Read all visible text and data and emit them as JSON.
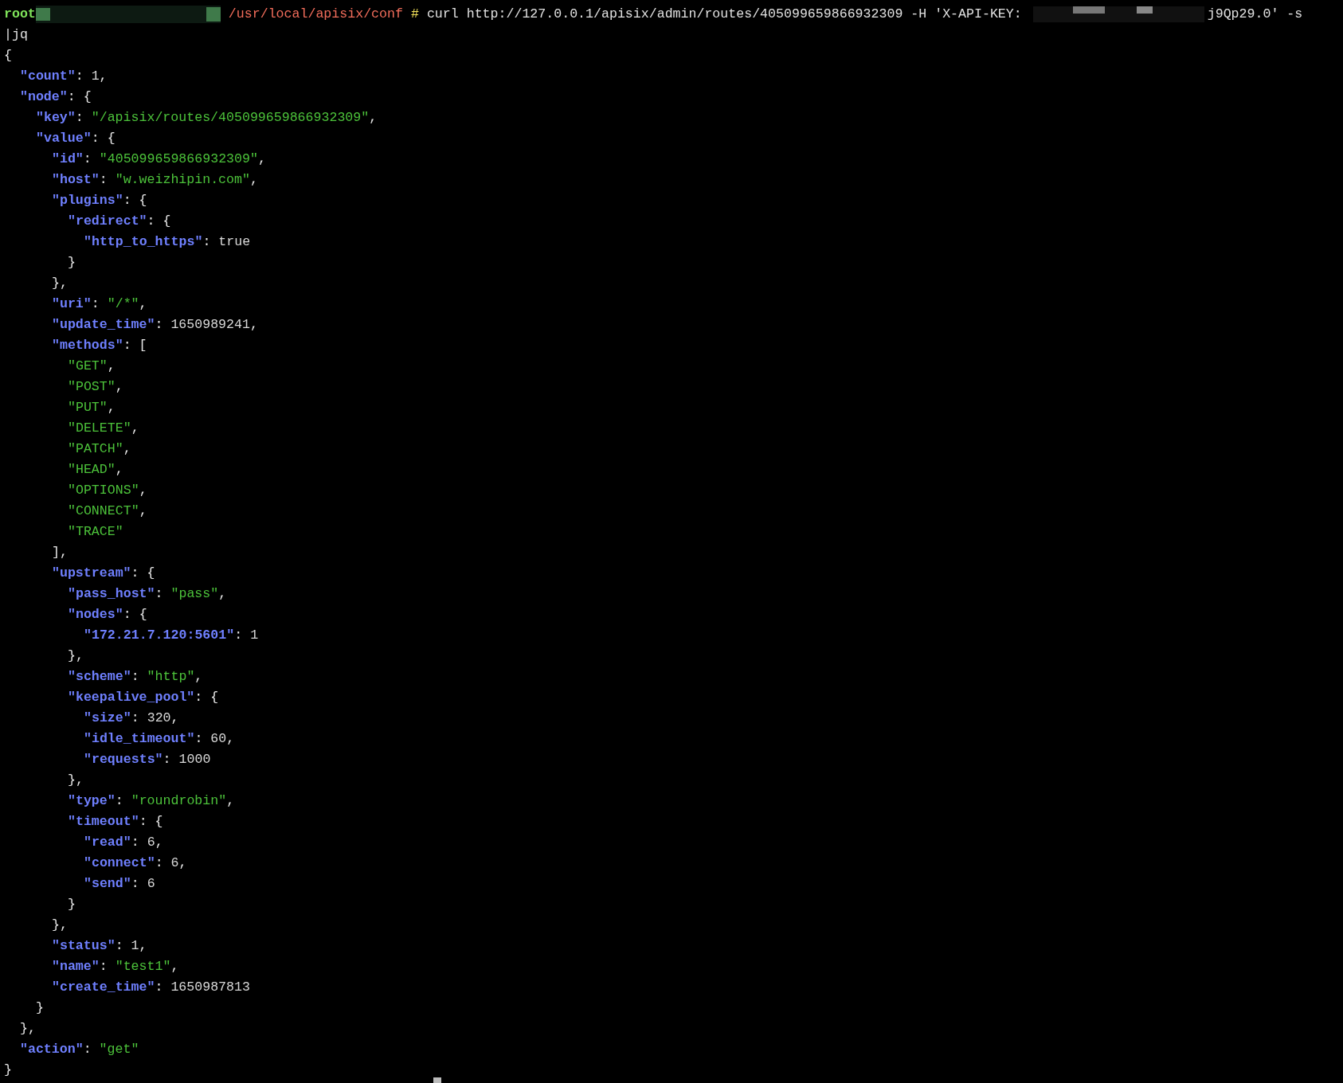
{
  "prompt": {
    "user": "root",
    "path": "/usr/local/apisix/conf",
    "symbol": "#",
    "command": "curl http://127.0.0.1/apisix/admin/routes/405099659866932309 -H 'X-API-KEY:",
    "command_tail": "j9Qp29.0' -s",
    "continuation": "|jq"
  },
  "output": [
    {
      "tokens": [
        {
          "kind": "punct",
          "text": "{"
        }
      ],
      "children": [
        {
          "tokens": [
            {
              "kind": "key",
              "text": "\"count\""
            },
            {
              "kind": "punct",
              "text": ": "
            },
            {
              "kind": "literal",
              "text": "1"
            },
            {
              "kind": "punct",
              "text": ","
            }
          ]
        },
        {
          "tokens": [
            {
              "kind": "key",
              "text": "\"node\""
            },
            {
              "kind": "punct",
              "text": ": {"
            }
          ],
          "children": [
            {
              "tokens": [
                {
                  "kind": "key",
                  "text": "\"key\""
                },
                {
                  "kind": "punct",
                  "text": ": "
                },
                {
                  "kind": "string",
                  "text": "\"/apisix/routes/405099659866932309\""
                },
                {
                  "kind": "punct",
                  "text": ","
                }
              ]
            },
            {
              "tokens": [
                {
                  "kind": "key",
                  "text": "\"value\""
                },
                {
                  "kind": "punct",
                  "text": ": {"
                }
              ],
              "children": [
                {
                  "tokens": [
                    {
                      "kind": "key",
                      "text": "\"id\""
                    },
                    {
                      "kind": "punct",
                      "text": ": "
                    },
                    {
                      "kind": "string",
                      "text": "\"405099659866932309\""
                    },
                    {
                      "kind": "punct",
                      "text": ","
                    }
                  ]
                },
                {
                  "tokens": [
                    {
                      "kind": "key",
                      "text": "\"host\""
                    },
                    {
                      "kind": "punct",
                      "text": ": "
                    },
                    {
                      "kind": "string",
                      "text": "\"w.weizhipin.com\""
                    },
                    {
                      "kind": "punct",
                      "text": ","
                    }
                  ]
                },
                {
                  "tokens": [
                    {
                      "kind": "key",
                      "text": "\"plugins\""
                    },
                    {
                      "kind": "punct",
                      "text": ": {"
                    }
                  ],
                  "children": [
                    {
                      "tokens": [
                        {
                          "kind": "key",
                          "text": "\"redirect\""
                        },
                        {
                          "kind": "punct",
                          "text": ": {"
                        }
                      ],
                      "children": [
                        {
                          "tokens": [
                            {
                              "kind": "key",
                              "text": "\"http_to_https\""
                            },
                            {
                              "kind": "punct",
                              "text": ": "
                            },
                            {
                              "kind": "literal",
                              "text": "true"
                            }
                          ]
                        }
                      ]
                    },
                    {
                      "tokens": [
                        {
                          "kind": "punct",
                          "text": "}"
                        }
                      ]
                    }
                  ]
                },
                {
                  "tokens": [
                    {
                      "kind": "punct",
                      "text": "},"
                    }
                  ]
                },
                {
                  "tokens": [
                    {
                      "kind": "key",
                      "text": "\"uri\""
                    },
                    {
                      "kind": "punct",
                      "text": ": "
                    },
                    {
                      "kind": "string",
                      "text": "\"/*\""
                    },
                    {
                      "kind": "punct",
                      "text": ","
                    }
                  ]
                },
                {
                  "tokens": [
                    {
                      "kind": "key",
                      "text": "\"update_time\""
                    },
                    {
                      "kind": "punct",
                      "text": ": "
                    },
                    {
                      "kind": "literal",
                      "text": "1650989241"
                    },
                    {
                      "kind": "punct",
                      "text": ","
                    }
                  ]
                },
                {
                  "tokens": [
                    {
                      "kind": "key",
                      "text": "\"methods\""
                    },
                    {
                      "kind": "punct",
                      "text": ": ["
                    }
                  ],
                  "children": [
                    {
                      "tokens": [
                        {
                          "kind": "string",
                          "text": "\"GET\""
                        },
                        {
                          "kind": "punct",
                          "text": ","
                        }
                      ]
                    },
                    {
                      "tokens": [
                        {
                          "kind": "string",
                          "text": "\"POST\""
                        },
                        {
                          "kind": "punct",
                          "text": ","
                        }
                      ]
                    },
                    {
                      "tokens": [
                        {
                          "kind": "string",
                          "text": "\"PUT\""
                        },
                        {
                          "kind": "punct",
                          "text": ","
                        }
                      ]
                    },
                    {
                      "tokens": [
                        {
                          "kind": "string",
                          "text": "\"DELETE\""
                        },
                        {
                          "kind": "punct",
                          "text": ","
                        }
                      ]
                    },
                    {
                      "tokens": [
                        {
                          "kind": "string",
                          "text": "\"PATCH\""
                        },
                        {
                          "kind": "punct",
                          "text": ","
                        }
                      ]
                    },
                    {
                      "tokens": [
                        {
                          "kind": "string",
                          "text": "\"HEAD\""
                        },
                        {
                          "kind": "punct",
                          "text": ","
                        }
                      ]
                    },
                    {
                      "tokens": [
                        {
                          "kind": "string",
                          "text": "\"OPTIONS\""
                        },
                        {
                          "kind": "punct",
                          "text": ","
                        }
                      ]
                    },
                    {
                      "tokens": [
                        {
                          "kind": "string",
                          "text": "\"CONNECT\""
                        },
                        {
                          "kind": "punct",
                          "text": ","
                        }
                      ]
                    },
                    {
                      "tokens": [
                        {
                          "kind": "string",
                          "text": "\"TRACE\""
                        }
                      ]
                    }
                  ]
                },
                {
                  "tokens": [
                    {
                      "kind": "punct",
                      "text": "],"
                    }
                  ]
                },
                {
                  "tokens": [
                    {
                      "kind": "key",
                      "text": "\"upstream\""
                    },
                    {
                      "kind": "punct",
                      "text": ": {"
                    }
                  ],
                  "children": [
                    {
                      "tokens": [
                        {
                          "kind": "key",
                          "text": "\"pass_host\""
                        },
                        {
                          "kind": "punct",
                          "text": ": "
                        },
                        {
                          "kind": "string",
                          "text": "\"pass\""
                        },
                        {
                          "kind": "punct",
                          "text": ","
                        }
                      ]
                    },
                    {
                      "tokens": [
                        {
                          "kind": "key",
                          "text": "\"nodes\""
                        },
                        {
                          "kind": "punct",
                          "text": ": {"
                        }
                      ],
                      "children": [
                        {
                          "tokens": [
                            {
                              "kind": "key",
                              "text": "\"172.21.7.120:5601\""
                            },
                            {
                              "kind": "punct",
                              "text": ": "
                            },
                            {
                              "kind": "literal",
                              "text": "1"
                            }
                          ]
                        }
                      ]
                    },
                    {
                      "tokens": [
                        {
                          "kind": "punct",
                          "text": "},"
                        }
                      ]
                    },
                    {
                      "tokens": [
                        {
                          "kind": "key",
                          "text": "\"scheme\""
                        },
                        {
                          "kind": "punct",
                          "text": ": "
                        },
                        {
                          "kind": "string",
                          "text": "\"http\""
                        },
                        {
                          "kind": "punct",
                          "text": ","
                        }
                      ]
                    },
                    {
                      "tokens": [
                        {
                          "kind": "key",
                          "text": "\"keepalive_pool\""
                        },
                        {
                          "kind": "punct",
                          "text": ": {"
                        }
                      ],
                      "children": [
                        {
                          "tokens": [
                            {
                              "kind": "key",
                              "text": "\"size\""
                            },
                            {
                              "kind": "punct",
                              "text": ": "
                            },
                            {
                              "kind": "literal",
                              "text": "320"
                            },
                            {
                              "kind": "punct",
                              "text": ","
                            }
                          ]
                        },
                        {
                          "tokens": [
                            {
                              "kind": "key",
                              "text": "\"idle_timeout\""
                            },
                            {
                              "kind": "punct",
                              "text": ": "
                            },
                            {
                              "kind": "literal",
                              "text": "60"
                            },
                            {
                              "kind": "punct",
                              "text": ","
                            }
                          ]
                        },
                        {
                          "tokens": [
                            {
                              "kind": "key",
                              "text": "\"requests\""
                            },
                            {
                              "kind": "punct",
                              "text": ": "
                            },
                            {
                              "kind": "literal",
                              "text": "1000"
                            }
                          ]
                        }
                      ]
                    },
                    {
                      "tokens": [
                        {
                          "kind": "punct",
                          "text": "},"
                        }
                      ]
                    },
                    {
                      "tokens": [
                        {
                          "kind": "key",
                          "text": "\"type\""
                        },
                        {
                          "kind": "punct",
                          "text": ": "
                        },
                        {
                          "kind": "string",
                          "text": "\"roundrobin\""
                        },
                        {
                          "kind": "punct",
                          "text": ","
                        }
                      ]
                    },
                    {
                      "tokens": [
                        {
                          "kind": "key",
                          "text": "\"timeout\""
                        },
                        {
                          "kind": "punct",
                          "text": ": {"
                        }
                      ],
                      "children": [
                        {
                          "tokens": [
                            {
                              "kind": "key",
                              "text": "\"read\""
                            },
                            {
                              "kind": "punct",
                              "text": ": "
                            },
                            {
                              "kind": "literal",
                              "text": "6"
                            },
                            {
                              "kind": "punct",
                              "text": ","
                            }
                          ]
                        },
                        {
                          "tokens": [
                            {
                              "kind": "key",
                              "text": "\"connect\""
                            },
                            {
                              "kind": "punct",
                              "text": ": "
                            },
                            {
                              "kind": "literal",
                              "text": "6"
                            },
                            {
                              "kind": "punct",
                              "text": ","
                            }
                          ]
                        },
                        {
                          "tokens": [
                            {
                              "kind": "key",
                              "text": "\"send\""
                            },
                            {
                              "kind": "punct",
                              "text": ": "
                            },
                            {
                              "kind": "literal",
                              "text": "6"
                            }
                          ]
                        }
                      ]
                    },
                    {
                      "tokens": [
                        {
                          "kind": "punct",
                          "text": "}"
                        }
                      ]
                    }
                  ]
                },
                {
                  "tokens": [
                    {
                      "kind": "punct",
                      "text": "},"
                    }
                  ]
                },
                {
                  "tokens": [
                    {
                      "kind": "key",
                      "text": "\"status\""
                    },
                    {
                      "kind": "punct",
                      "text": ": "
                    },
                    {
                      "kind": "literal",
                      "text": "1"
                    },
                    {
                      "kind": "punct",
                      "text": ","
                    }
                  ]
                },
                {
                  "tokens": [
                    {
                      "kind": "key",
                      "text": "\"name\""
                    },
                    {
                      "kind": "punct",
                      "text": ": "
                    },
                    {
                      "kind": "string",
                      "text": "\"test1\""
                    },
                    {
                      "kind": "punct",
                      "text": ","
                    }
                  ]
                },
                {
                  "tokens": [
                    {
                      "kind": "key",
                      "text": "\"create_time\""
                    },
                    {
                      "kind": "punct",
                      "text": ": "
                    },
                    {
                      "kind": "literal",
                      "text": "1650987813"
                    }
                  ]
                }
              ]
            },
            {
              "tokens": [
                {
                  "kind": "punct",
                  "text": "}"
                }
              ]
            }
          ]
        },
        {
          "tokens": [
            {
              "kind": "punct",
              "text": "},"
            }
          ]
        },
        {
          "tokens": [
            {
              "kind": "key",
              "text": "\"action\""
            },
            {
              "kind": "punct",
              "text": ": "
            },
            {
              "kind": "string",
              "text": "\"get\""
            }
          ]
        }
      ]
    },
    {
      "tokens": [
        {
          "kind": "punct",
          "text": "}"
        }
      ]
    }
  ]
}
